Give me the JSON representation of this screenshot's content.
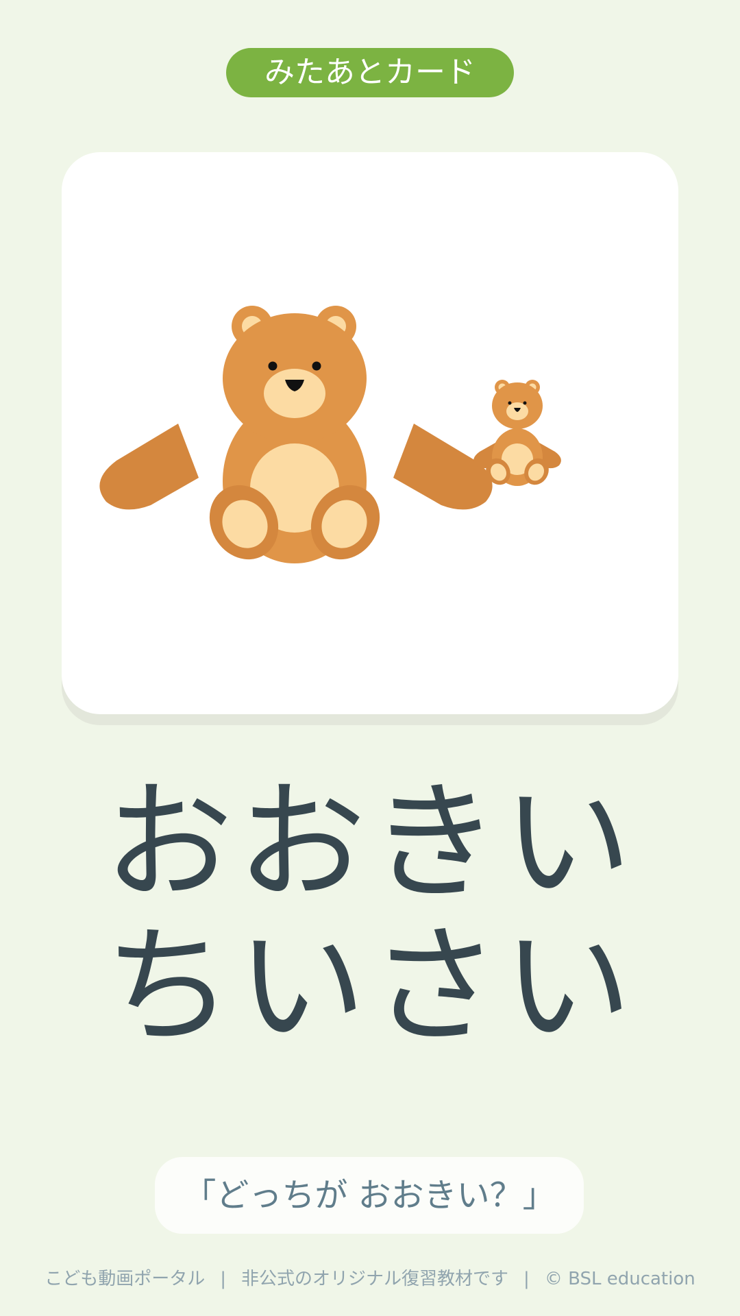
{
  "badge": {
    "label": "みたあとカード"
  },
  "card": {
    "illustration": {
      "large_item": "large-teddy-bear",
      "small_item": "small-teddy-bear",
      "colors": {
        "fur": "#e09548",
        "fur_dark": "#d4873e",
        "belly": "#fcdba3",
        "nose": "#111111"
      }
    }
  },
  "title": {
    "line1": "おおきい",
    "line2": "ちいさい"
  },
  "prompt": {
    "text": "「どっちが おおきい？」"
  },
  "footer": {
    "portal": "こども動画ポータル",
    "note": "非公式のオリジナル復習教材です",
    "copyright": "© BSL education",
    "separator": "|"
  },
  "colors": {
    "background": "#f0f6e8",
    "badge": "#7cb342",
    "title_text": "#37474f",
    "prompt_text": "#607d8b",
    "footer_text": "#90a4ae"
  }
}
